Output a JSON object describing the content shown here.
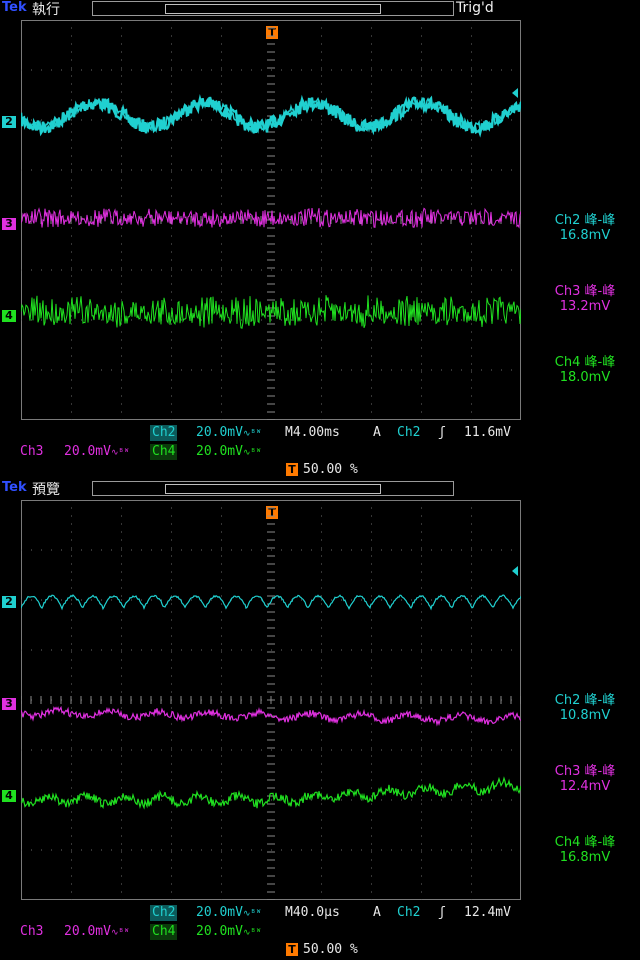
{
  "colors": {
    "ch2": "#20d0d0",
    "ch3": "#e030e0",
    "ch4": "#20e020",
    "trigger": "#ff7a00",
    "brand": "#3050ff"
  },
  "panels": [
    {
      "brand": "Tek",
      "mode": "執行",
      "trig_status": "Trig'd",
      "trigger_marker": "T",
      "channel_markers": [
        "2",
        "3",
        "4"
      ],
      "measurements": [
        {
          "label": "Ch2 峰-峰",
          "value": "16.8mV"
        },
        {
          "label": "Ch3 峰-峰",
          "value": "13.2mV"
        },
        {
          "label": "Ch4 峰-峰",
          "value": "18.0mV"
        }
      ],
      "status": {
        "ch2": "Ch2",
        "ch2_scale": "20.0mV",
        "ch3": "Ch3",
        "ch3_scale": "20.0mV",
        "ch4": "Ch4",
        "ch4_scale": "20.0mV",
        "timebase": "M4.00ms",
        "trig_type": "A",
        "trig_src": "Ch2",
        "trig_level": "11.6mV",
        "position": "50.00 %"
      }
    },
    {
      "brand": "Tek",
      "mode": "預覽",
      "trig_status": "",
      "trigger_marker": "T",
      "channel_markers": [
        "2",
        "3",
        "4"
      ],
      "measurements": [
        {
          "label": "Ch2 峰-峰",
          "value": "10.8mV"
        },
        {
          "label": "Ch3 峰-峰",
          "value": "12.4mV"
        },
        {
          "label": "Ch4 峰-峰",
          "value": "16.8mV"
        }
      ],
      "status": {
        "ch2": "Ch2",
        "ch2_scale": "20.0mV",
        "ch3": "Ch3",
        "ch3_scale": "20.0mV",
        "ch4": "Ch4",
        "ch4_scale": "20.0mV",
        "timebase": "M40.0µs",
        "trig_type": "A",
        "trig_src": "Ch2",
        "trig_level": "12.4mV",
        "position": "50.00 %"
      }
    }
  ]
}
